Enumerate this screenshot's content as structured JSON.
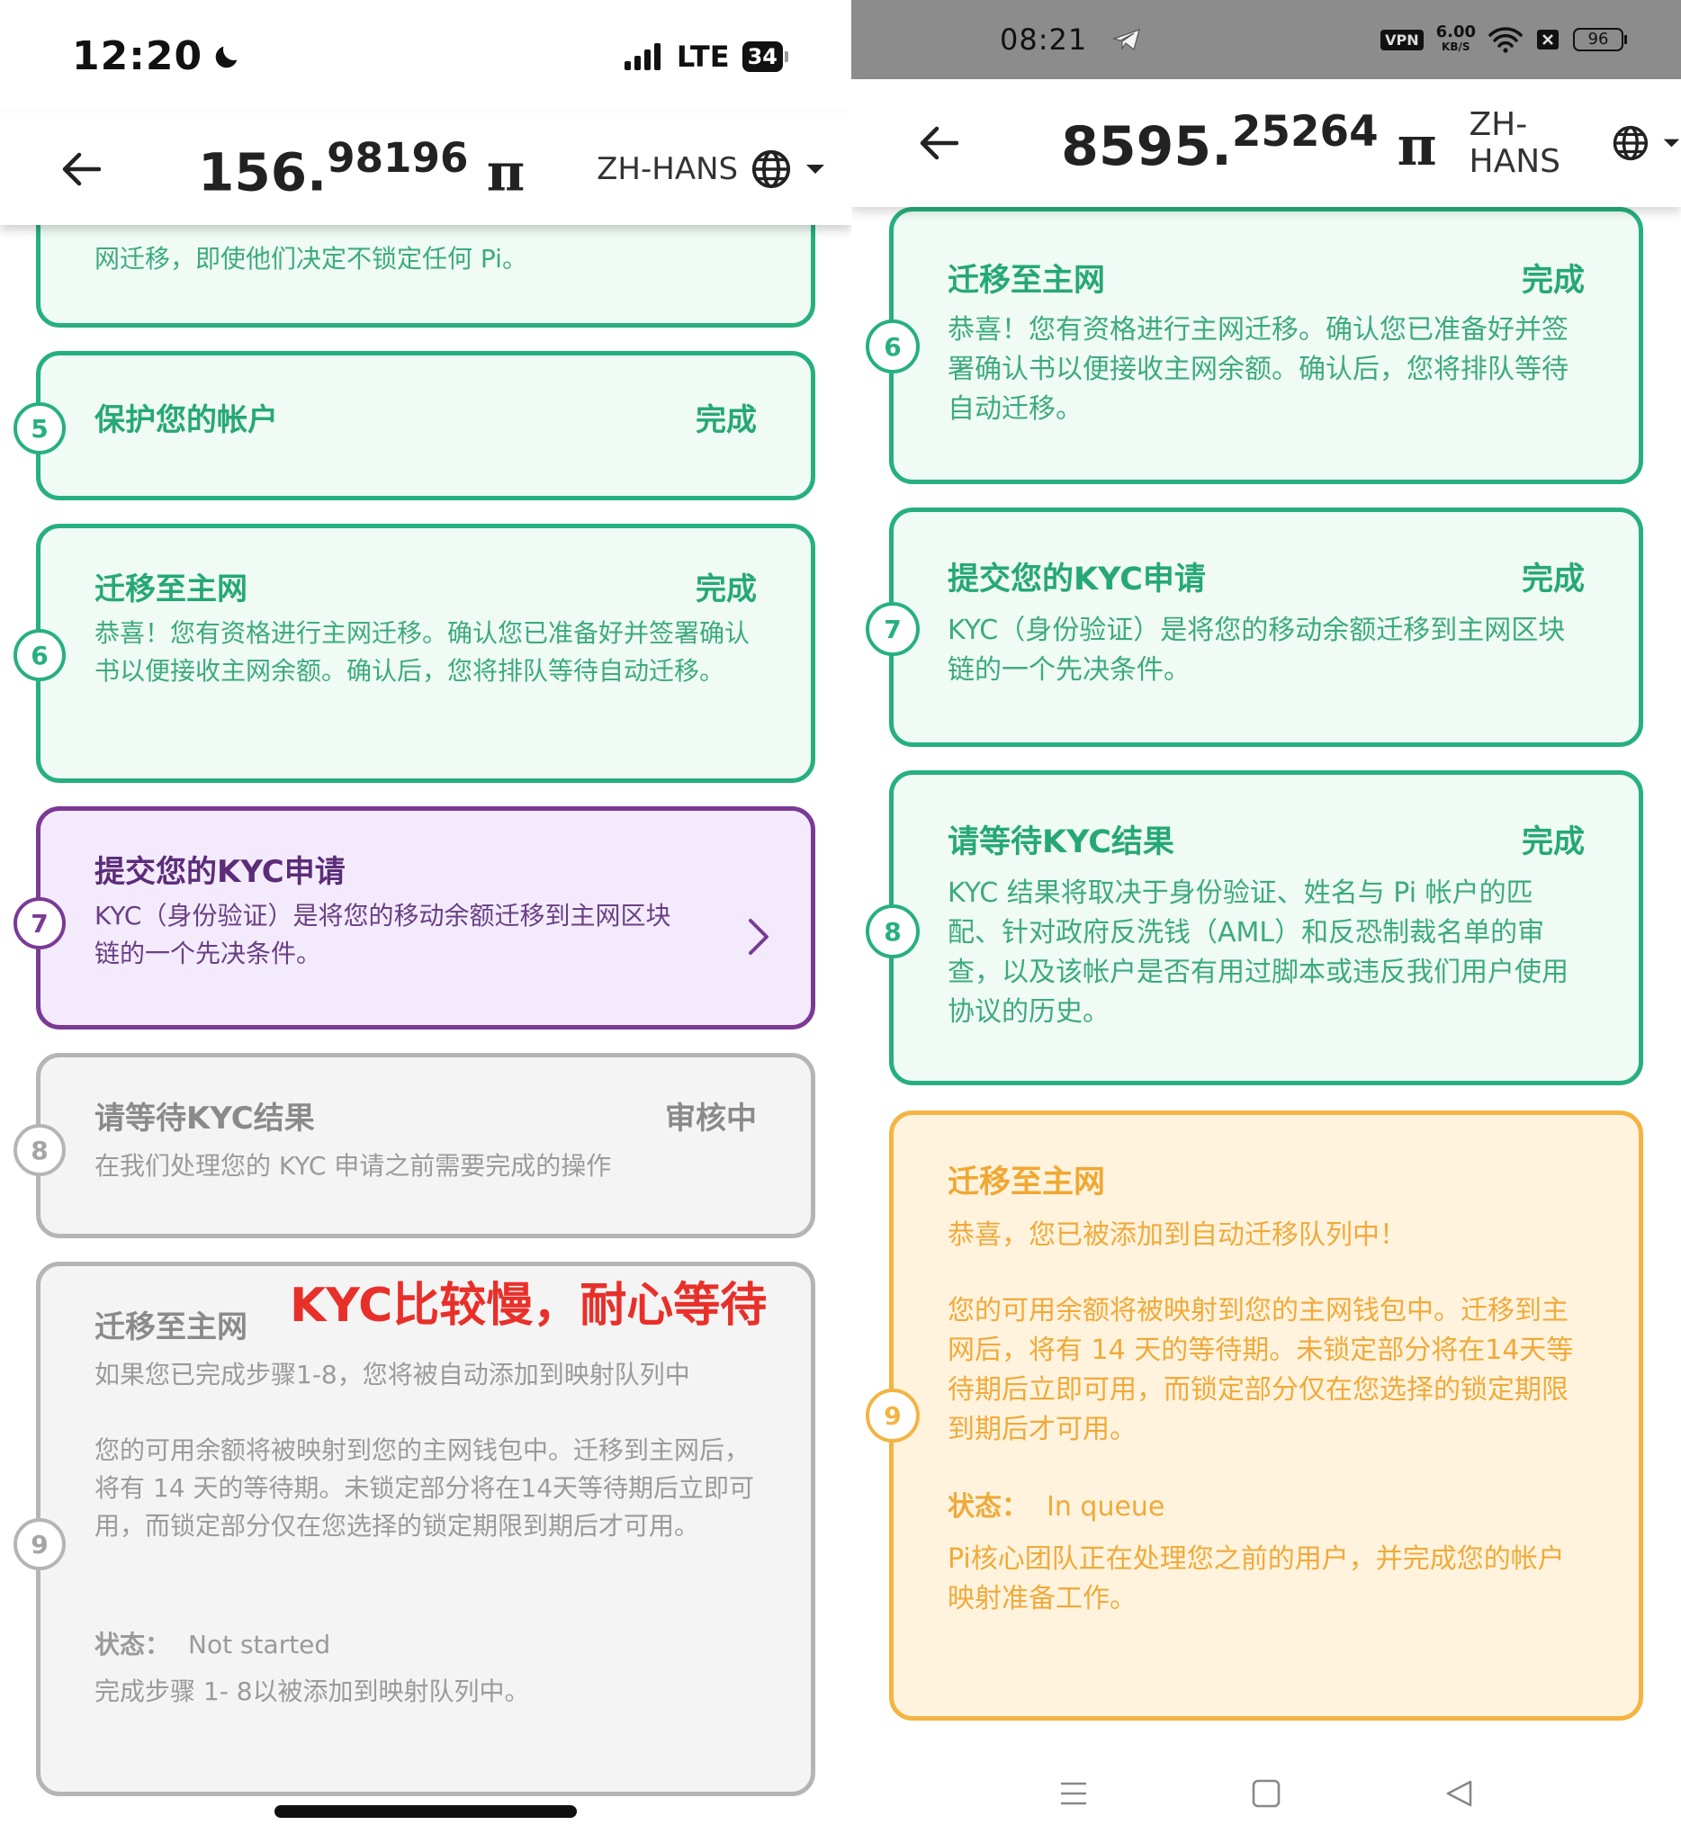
{
  "left": {
    "status": {
      "time": "12:20",
      "network": "LTE",
      "battery": "34"
    },
    "header": {
      "balance_int": "156.",
      "balance_dec": "98196",
      "currency": "π",
      "language": "ZH-HANS"
    },
    "steps": [
      {
        "body": "网迁移，即使他们决定不锁定任何 Pi。"
      },
      {
        "num": "5",
        "title": "保护您的帐户",
        "status": "完成"
      },
      {
        "num": "6",
        "title": "迁移至主网",
        "status": "完成",
        "body": "恭喜！您有资格进行主网迁移。确认您已准备好并签署确认书以便接收主网余额。确认后，您将排队等待自动迁移。"
      },
      {
        "num": "7",
        "title": "提交您的KYC申请",
        "body": "KYC（身份验证）是将您的移动余额迁移到主网区块链的一个先决条件。"
      },
      {
        "num": "8",
        "title": "请等待KYC结果",
        "status": "审核中",
        "body": "在我们处理您的 KYC 申请之前需要完成的操作"
      },
      {
        "num": "9",
        "title": "迁移至主网",
        "body": "如果您已完成步骤1-8，您将被自动添加到映射队列中",
        "body2": "您的可用余额将被映射到您的主网钱包中。迁移到主网后，将有 14 天的等待期。未锁定部分将在14天等待期后立即可用，而锁定部分仅在您选择的锁定期限到期后才可用。",
        "status_label": "状态：",
        "status_value": "Not started",
        "body3": "完成步骤 1- 8以被添加到映射队列中。"
      }
    ],
    "annotation": "KYC比较慢，耐心等待"
  },
  "right": {
    "status": {
      "time": "08:21",
      "vpn": "VPN",
      "speed": "6.00",
      "speed_unit": "KB/S",
      "battery": "96"
    },
    "header": {
      "balance_int": "8595.",
      "balance_dec": "25264",
      "currency": "π",
      "language": "ZH-HANS"
    },
    "steps": [
      {
        "num": "6",
        "title": "迁移至主网",
        "status": "完成",
        "body": "恭喜！您有资格进行主网迁移。确认您已准备好并签署确认书以便接收主网余额。确认后，您将排队等待自动迁移。"
      },
      {
        "num": "7",
        "title": "提交您的KYC申请",
        "status": "完成",
        "body": "KYC（身份验证）是将您的移动余额迁移到主网区块链的一个先决条件。"
      },
      {
        "num": "8",
        "title": "请等待KYC结果",
        "status": "完成",
        "body": "KYC 结果将取决于身份验证、姓名与 Pi 帐户的匹配、针对政府反洗钱（AML）和反恐制裁名单的审查，以及该帐户是否有用过脚本或违反我们用户使用协议的历史。"
      },
      {
        "num": "9",
        "title": "迁移至主网",
        "body": "恭喜，您已被添加到自动迁移队列中！",
        "body2": "您的可用余额将被映射到您的主网钱包中。迁移到主网后，将有 14 天的等待期。未锁定部分将在14天等待期后立即可用，而锁定部分仅在您选择的锁定期限到期后才可用。",
        "status_label": "状态：",
        "status_value": "In queue",
        "body3": "Pi核心团队正在处理您之前的用户，并完成您的帐户映射准备工作。"
      }
    ]
  },
  "colors": {
    "done": "#27b07f",
    "active": "#7a3a95",
    "pending": "#b5b5b5",
    "queue": "#f3b443",
    "annotation": "#e8302a"
  }
}
